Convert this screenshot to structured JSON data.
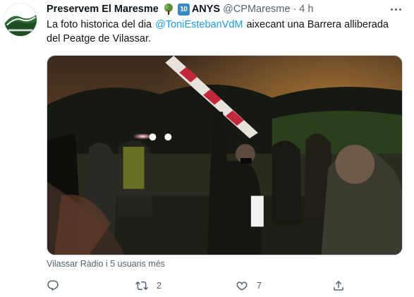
{
  "tweet": {
    "display_name": "Preservem El Maresme",
    "badge_number": "10",
    "badge_word": "ANYS",
    "handle": "@CPMaresme",
    "separator": "·",
    "time": "4 h",
    "text_before": "La foto historica del dia",
    "mention": "@ToniEstebanVdM",
    "text_after": "aixecant una Barrera alliberada del Peatge de Vilassar.",
    "tagged_users": "Vilassar Ràdio i 5 usuaris més",
    "icons": {
      "more": "more-options-icon",
      "tree": "tree-emoji-icon",
      "reply": "reply-icon",
      "retweet": "retweet-icon",
      "like": "heart-icon",
      "share": "share-icon"
    },
    "metrics": {
      "replies": "",
      "retweets": "2",
      "likes": "7"
    },
    "colors": {
      "link": "#1d9bf0",
      "secondary_text": "#536471",
      "primary_text": "#0f1419"
    }
  }
}
